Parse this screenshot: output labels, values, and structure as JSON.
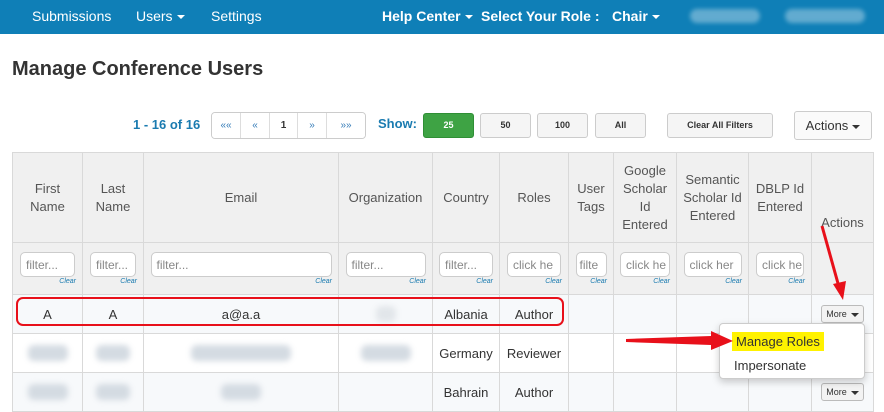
{
  "nav": {
    "submissions": "Submissions",
    "users": "Users",
    "settings": "Settings",
    "help_center": "Help Center",
    "select_role_label": "Select Your Role :",
    "role_value": "Chair"
  },
  "page": {
    "title": "Manage Conference Users"
  },
  "pagination": {
    "range": "1 - 16 of 16",
    "first": "««",
    "prev": "«",
    "current": "1",
    "next": "»",
    "last": "»»"
  },
  "show": {
    "label": "Show:",
    "options": [
      "25",
      "50",
      "100",
      "All"
    ],
    "active": "25"
  },
  "toolbar": {
    "clear_all_filters": "Clear All Filters",
    "actions": "Actions"
  },
  "table": {
    "headers": {
      "first_name": "First Name",
      "last_name": "Last Name",
      "email": "Email",
      "organization": "Organization",
      "country": "Country",
      "roles": "Roles",
      "user_tags": "User Tags",
      "google_scholar": "Google Scholar Id Entered",
      "semantic_scholar": "Semantic Scholar Id Entered",
      "dblp": "DBLP Id Entered",
      "actions": "Actions"
    },
    "filters": {
      "placeholder": "filter...",
      "short_placeholder": "filte",
      "click_placeholder": "click he",
      "click_placeholder_2": "click he",
      "click_placeholder_3": "click her",
      "click_placeholder_4": "click he",
      "clear": "Clear"
    },
    "rows": [
      {
        "first": "A",
        "last": "A",
        "email": "a@a.a",
        "org": "",
        "country": "Albania",
        "role": "Author",
        "action": "More"
      },
      {
        "first": "",
        "last": "",
        "email": "",
        "org": "",
        "country": "Germany",
        "role": "Reviewer",
        "action": ""
      },
      {
        "first": "",
        "last": "",
        "email": "",
        "org": "",
        "country": "Bahrain",
        "role": "Author",
        "action": "More"
      }
    ]
  },
  "dropdown": {
    "manage_roles": "Manage Roles",
    "impersonate": "Impersonate"
  },
  "colors": {
    "nav_bg": "#0f7fb7",
    "active_green": "#3ea344",
    "annotation_red": "#e8101a",
    "highlight_yellow": "#fff200"
  }
}
